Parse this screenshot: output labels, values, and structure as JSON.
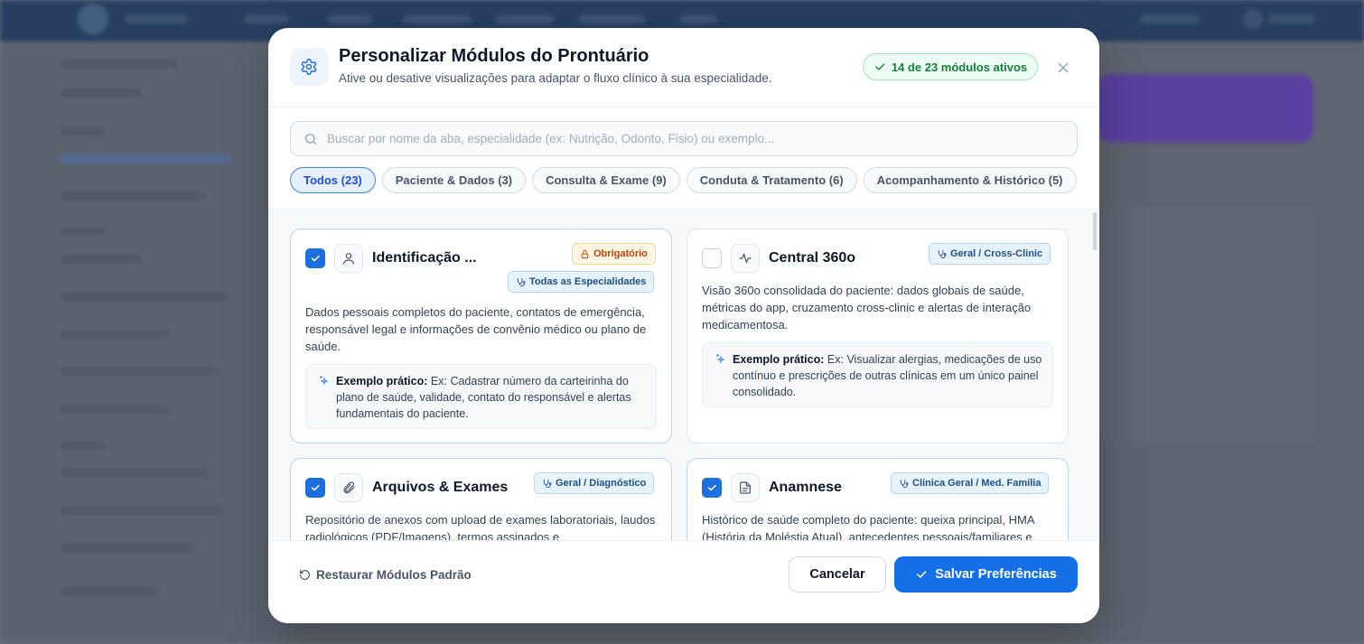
{
  "modal": {
    "title": "Personalizar Módulos do Prontuário",
    "subtitle": "Ative ou desative visualizações para adaptar o fluxo clínico à sua especialidade.",
    "active_badge": "14 de 23 módulos ativos"
  },
  "search": {
    "placeholder": "Buscar por nome da aba, especialidade (ex: Nutrição, Odonto, Fisio) ou exemplo..."
  },
  "filters": [
    {
      "label": "Todos (23)",
      "active": true
    },
    {
      "label": "Paciente & Dados (3)",
      "active": false
    },
    {
      "label": "Consulta & Exame (9)",
      "active": false
    },
    {
      "label": "Conduta & Tratamento (6)",
      "active": false
    },
    {
      "label": "Acompanhamento & Histórico (5)",
      "active": false
    }
  ],
  "example_label": "Exemplo prático:",
  "cards": [
    {
      "title": "Identificação ...",
      "checked": true,
      "icon": "user-icon",
      "tags": [
        "Obrigatório",
        "Todas as Especialidades"
      ],
      "description": "Dados pessoais completos do paciente, contatos de emergência, responsável legal e informações de convênio médico ou plano de saúde.",
      "example": "Ex: Cadastrar número da carteirinha do plano de saúde, validade, contato do responsável e alertas fundamentais do paciente."
    },
    {
      "title": "Central 360o",
      "checked": false,
      "icon": "activity-icon",
      "tags": [
        "Geral / Cross-Clinic"
      ],
      "description": "Visão 360o consolidada do paciente: dados globais de saúde, métricas do app, cruzamento cross-clinic e alertas de interação medicamentosa.",
      "example": "Ex: Visualizar alergias, medicações de uso contínuo e prescrições de outras clínicas em um único painel consolidado."
    },
    {
      "title": "Arquivos & Exames",
      "checked": true,
      "icon": "paperclip-icon",
      "tags": [
        "Geral / Diagnóstico"
      ],
      "description": "Repositório de anexos com upload de exames laboratoriais, laudos radiológicos (PDF/Imagens), termos assinados e"
    },
    {
      "title": "Anamnese",
      "checked": true,
      "icon": "document-icon",
      "tags": [
        "Clínica Geral / Med. Família"
      ],
      "description": "Histórico de saúde completo do paciente: queixa principal, HMA (História da Moléstia Atual), antecedentes pessoais/familiares e"
    }
  ],
  "footer": {
    "restore_label": "Restaurar Módulos Padrão",
    "cancel_label": "Cancelar",
    "save_label": "Salvar Preferências"
  },
  "colors": {
    "primary": "#1570e8",
    "success": "#15803d",
    "warning": "#c2410c"
  }
}
